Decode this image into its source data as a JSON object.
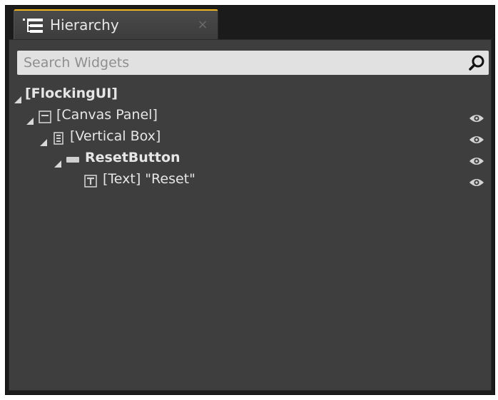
{
  "tab": {
    "title": "Hierarchy",
    "close_glyph": "×",
    "icon": "hierarchy-icon"
  },
  "search": {
    "placeholder": "Search Widgets",
    "value": "",
    "icon": "search-icon"
  },
  "tree": {
    "items": [
      {
        "label": "[FlockingUI]",
        "icon": "",
        "bold": true,
        "expanded": true,
        "visible_toggle": false
      },
      {
        "label": "[Canvas Panel]",
        "icon": "canvas-panel-icon",
        "bold": false,
        "expanded": true,
        "visible_toggle": true
      },
      {
        "label": "[Vertical Box]",
        "icon": "vertical-box-icon",
        "bold": false,
        "expanded": true,
        "visible_toggle": true
      },
      {
        "label": "ResetButton",
        "icon": "button-icon",
        "bold": true,
        "expanded": true,
        "visible_toggle": true
      },
      {
        "label": "[Text] \"Reset\"",
        "icon": "text-icon",
        "bold": false,
        "expanded": false,
        "visible_toggle": true
      }
    ]
  },
  "colors": {
    "tab_accent": "#f2b51c",
    "panel_bg": "#3e3e3e",
    "window_bg": "#1b1b1b",
    "text": "#e6e6e6",
    "search_bg": "#e1e1e1"
  }
}
